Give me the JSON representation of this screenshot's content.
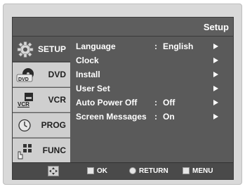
{
  "header": {
    "title": "Setup"
  },
  "sidebar": {
    "items": [
      {
        "label": "SETUP",
        "icon": "gear-icon",
        "active": true
      },
      {
        "label": "DVD",
        "icon": "dvd-icon",
        "active": false
      },
      {
        "label": "VCR",
        "icon": "vcr-icon",
        "active": false
      },
      {
        "label": "PROG",
        "icon": "clock-icon",
        "active": false
      },
      {
        "label": "FUNC",
        "icon": "func-icon",
        "active": false
      }
    ],
    "dvd_logo_text": "DVD",
    "vcr_logo_text": "VCR"
  },
  "menu": {
    "items": [
      {
        "label": "Language",
        "colon": ":",
        "value": "English"
      },
      {
        "label": "Clock",
        "colon": "",
        "value": ""
      },
      {
        "label": "Install",
        "colon": "",
        "value": ""
      },
      {
        "label": "User Set",
        "colon": "",
        "value": ""
      },
      {
        "label": "Auto Power Off",
        "colon": ":",
        "value": "Off"
      },
      {
        "label": "Screen Messages",
        "colon": ":",
        "value": "On"
      }
    ]
  },
  "footer": {
    "nav_icon": "navigation-pad-icon",
    "ok_label": "OK",
    "return_label": "RETURN",
    "menu_label": "MENU"
  },
  "colors": {
    "osd_background": "#5a5a5a",
    "sidebar_inactive": "#cfcfcf",
    "text": "#ffffff"
  }
}
